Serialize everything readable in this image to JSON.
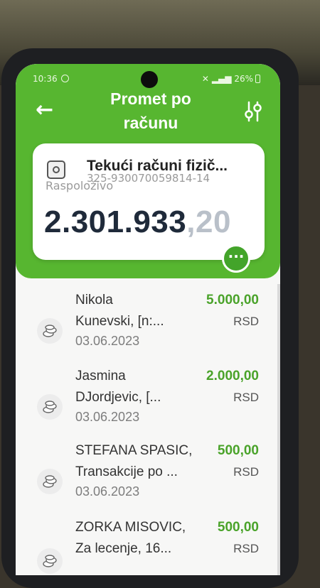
{
  "status_bar": {
    "time": "10:36",
    "battery": "26%",
    "icons": [
      "whatsapp-icon",
      "mute-icon",
      "wifi-icon",
      "signal-icon",
      "battery-icon"
    ]
  },
  "header": {
    "title_line1": "Promet po",
    "title_line2": "računu",
    "back_icon": "arrow-left-icon",
    "filter_icon": "sliders-icon",
    "background_color": "#57b630"
  },
  "account": {
    "name": "Tekući računi fizič...",
    "number": "325-930070059814-14",
    "available_label": "Raspoloživo",
    "balance_integer": "2.301.933",
    "balance_decimals": ",20",
    "more_label": "···"
  },
  "transactions": [
    {
      "name_line1": "Nikola",
      "name_line2": "Kunevski, [n:...",
      "date": "03.06.2023",
      "amount": "5.000,00",
      "currency": "RSD"
    },
    {
      "name_line1": "Jasmina",
      "name_line2": "DJordjevic, [...",
      "date": "03.06.2023",
      "amount": "2.000,00",
      "currency": "RSD"
    },
    {
      "name_line1": "STEFANA SPASIC,",
      "name_line2": "Transakcije po ...",
      "date": "03.06.2023",
      "amount": "500,00",
      "currency": "RSD"
    },
    {
      "name_line1": "ZORKA MISOVIC,",
      "name_line2": "Za  lecenje, 16...",
      "date": "",
      "amount": "500,00",
      "currency": "RSD"
    }
  ],
  "colors": {
    "accent_green": "#57b630",
    "amount_green": "#4aa32a",
    "balance_text": "#1f2a3a"
  }
}
